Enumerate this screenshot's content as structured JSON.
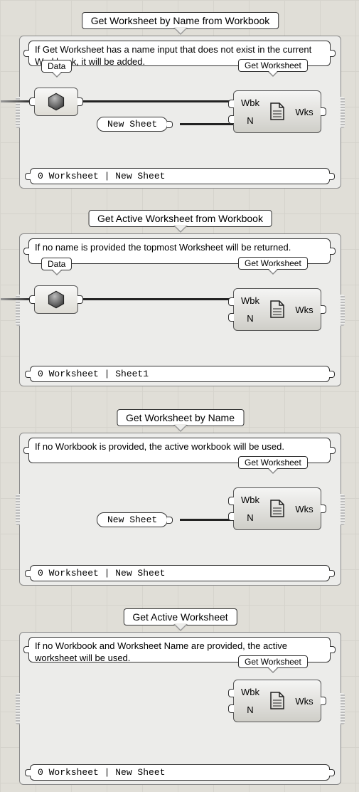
{
  "groups": [
    {
      "title": "Get Worksheet by Name from Workbook",
      "desc": "If Get Worksheet has a name input that does not exist in the current Workbook, it will be added.",
      "data_label": "Data",
      "comp_label": "Get Worksheet",
      "sheet_input": "New Sheet",
      "result": "0 Worksheet | New Sheet",
      "wbk": "Wbk",
      "n": "N",
      "wks": "Wks"
    },
    {
      "title": "Get Active Worksheet from Workbook",
      "desc": "If no name is provided the topmost Worksheet will be returned.",
      "data_label": "Data",
      "comp_label": "Get Worksheet",
      "sheet_input": null,
      "result": "0 Worksheet | Sheet1",
      "wbk": "Wbk",
      "n": "N",
      "wks": "Wks"
    },
    {
      "title": "Get Worksheet by Name",
      "desc": "If no Workbook is provided, the active workbook will be used.",
      "data_label": null,
      "comp_label": "Get Worksheet",
      "sheet_input": "New Sheet",
      "result": "0 Worksheet | New Sheet",
      "wbk": "Wbk",
      "n": "N",
      "wks": "Wks"
    },
    {
      "title": "Get Active Worksheet",
      "desc": "If no Workbook and Worksheet Name are provided, the active worksheet will be used.",
      "data_label": null,
      "comp_label": "Get Worksheet",
      "sheet_input": null,
      "result": "0 Worksheet | New Sheet",
      "wbk": "Wbk",
      "n": "N",
      "wks": "Wks"
    }
  ]
}
